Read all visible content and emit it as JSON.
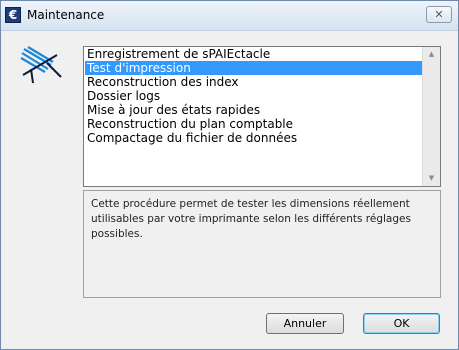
{
  "window": {
    "title": "Maintenance",
    "icon": "app-euro-icon",
    "close_icon": "close-icon"
  },
  "list": {
    "items": [
      {
        "label": "Enregistrement de sPAIEctacle",
        "selected": false
      },
      {
        "label": "Test d'impression",
        "selected": true
      },
      {
        "label": "Reconstruction des index",
        "selected": false
      },
      {
        "label": "Dossier logs",
        "selected": false
      },
      {
        "label": "Mise à jour des états rapides",
        "selected": false
      },
      {
        "label": "Reconstruction du plan comptable",
        "selected": false
      },
      {
        "label": "Compactage du fichier de données",
        "selected": false
      }
    ]
  },
  "description": {
    "text": "Cette procédure permet de tester les dimensions réellement utilisables par votre imprimante selon les différents réglages possibles."
  },
  "buttons": {
    "cancel_label": "Annuler",
    "ok_label": "OK"
  },
  "colors": {
    "selection": "#3399ff",
    "logo_blue": "#1e88d8"
  }
}
